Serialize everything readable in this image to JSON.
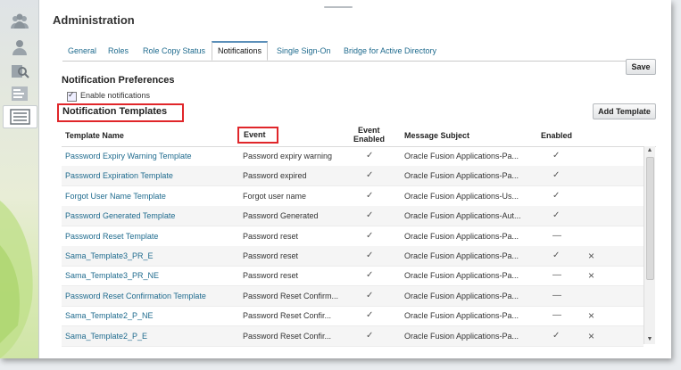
{
  "page": {
    "title": "Administration"
  },
  "tabs": [
    {
      "label": "General",
      "active": false
    },
    {
      "label": "Roles",
      "active": false
    },
    {
      "label": "Role Copy Status",
      "active": false
    },
    {
      "label": "Notifications",
      "active": true
    },
    {
      "label": "Single Sign-On",
      "active": false
    },
    {
      "label": "Bridge for Active Directory",
      "active": false
    }
  ],
  "buttons": {
    "save": "Save",
    "add_template": "Add Template"
  },
  "preferences": {
    "heading": "Notification Preferences",
    "enable_label": "Enable notifications",
    "enabled": true
  },
  "templates": {
    "heading": "Notification Templates",
    "columns": {
      "name": "Template Name",
      "event": "Event",
      "event_enabled_1": "Event",
      "event_enabled_2": "Enabled",
      "subject": "Message Subject",
      "enabled": "Enabled"
    },
    "rows": [
      {
        "name": "Password Expiry Warning Template",
        "event": "Password expiry warning",
        "event_enabled": "✓",
        "subject": "Oracle Fusion Applications-Pa...",
        "enabled": "✓",
        "delete": ""
      },
      {
        "name": "Password Expiration Template",
        "event": "Password expired",
        "event_enabled": "✓",
        "subject": "Oracle Fusion Applications-Pa...",
        "enabled": "✓",
        "delete": ""
      },
      {
        "name": "Forgot User Name Template",
        "event": "Forgot user name",
        "event_enabled": "✓",
        "subject": "Oracle Fusion Applications-Us...",
        "enabled": "✓",
        "delete": ""
      },
      {
        "name": "Password Generated Template",
        "event": "Password Generated",
        "event_enabled": "✓",
        "subject": "Oracle Fusion Applications-Aut...",
        "enabled": "✓",
        "delete": ""
      },
      {
        "name": "Password Reset Template",
        "event": "Password reset",
        "event_enabled": "✓",
        "subject": "Oracle Fusion Applications-Pa...",
        "enabled": "—",
        "delete": ""
      },
      {
        "name": "Sama_Template3_PR_E",
        "event": "Password reset",
        "event_enabled": "✓",
        "subject": "Oracle Fusion Applications-Pa...",
        "enabled": "✓",
        "delete": "×"
      },
      {
        "name": "Sama_Template3_PR_NE",
        "event": "Password reset",
        "event_enabled": "✓",
        "subject": "Oracle Fusion Applications-Pa...",
        "enabled": "—",
        "delete": "×"
      },
      {
        "name": "Password Reset Confirmation Template",
        "event": "Password Reset Confirm...",
        "event_enabled": "✓",
        "subject": "Oracle Fusion Applications-Pa...",
        "enabled": "—",
        "delete": ""
      },
      {
        "name": "Sama_Template2_P_NE",
        "event": "Password Reset Confir...",
        "event_enabled": "✓",
        "subject": "Oracle Fusion Applications-Pa...",
        "enabled": "—",
        "delete": "×"
      },
      {
        "name": "Sama_Template2_P_E",
        "event": "Password Reset Confir...",
        "event_enabled": "✓",
        "subject": "Oracle Fusion Applications-Pa...",
        "enabled": "✓",
        "delete": "×"
      }
    ]
  },
  "rail_icons": [
    "users-icon",
    "user-icon",
    "user-search-icon",
    "report-icon",
    "list-icon"
  ],
  "colors": {
    "link": "#1f6b8e",
    "highlight_border": "#e0262a",
    "active_tab_top": "#5b8fb9"
  }
}
